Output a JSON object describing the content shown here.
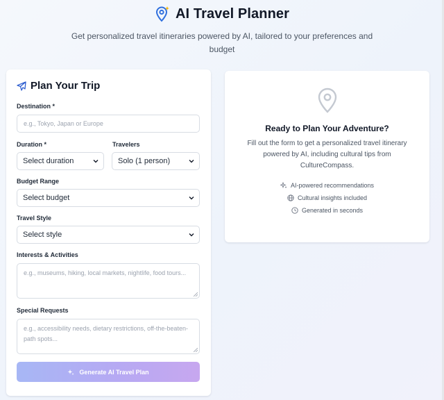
{
  "header": {
    "title": "AI Travel Planner",
    "subtitle": "Get personalized travel itineraries powered by AI, tailored to your preferences and budget",
    "icon": "map-pin-sparkle-icon"
  },
  "form": {
    "title": "Plan Your Trip",
    "destination": {
      "label": "Destination *",
      "placeholder": "e.g., Tokyo, Japan or Europe"
    },
    "duration": {
      "label": "Duration *",
      "value": "Select duration"
    },
    "travelers": {
      "label": "Travelers",
      "value": "Solo (1 person)"
    },
    "budget": {
      "label": "Budget Range",
      "value": "Select budget"
    },
    "style": {
      "label": "Travel Style",
      "value": "Select style"
    },
    "interests": {
      "label": "Interests & Activities",
      "placeholder": "e.g., museums, hiking, local markets, nightlife, food tours..."
    },
    "special": {
      "label": "Special Requests",
      "placeholder": "e.g., accessibility needs, dietary restrictions, off-the-beaten-path spots..."
    },
    "submit_label": "Generate AI Travel Plan"
  },
  "ready_panel": {
    "title": "Ready to Plan Your Adventure?",
    "description": "Fill out the form to get a personalized travel itinerary powered by AI, including cultural tips from CultureCompass.",
    "features": [
      {
        "icon": "sparkles-icon",
        "text": "AI-powered recommendations"
      },
      {
        "icon": "globe-icon",
        "text": "Cultural insights included"
      },
      {
        "icon": "clock-icon",
        "text": "Generated in seconds"
      }
    ]
  },
  "colors": {
    "accent_blue": "#3b82f6",
    "accent_gold": "#f5b400",
    "button_gradient_start": "#a7b7f5",
    "button_gradient_end": "#c7a7ef"
  }
}
